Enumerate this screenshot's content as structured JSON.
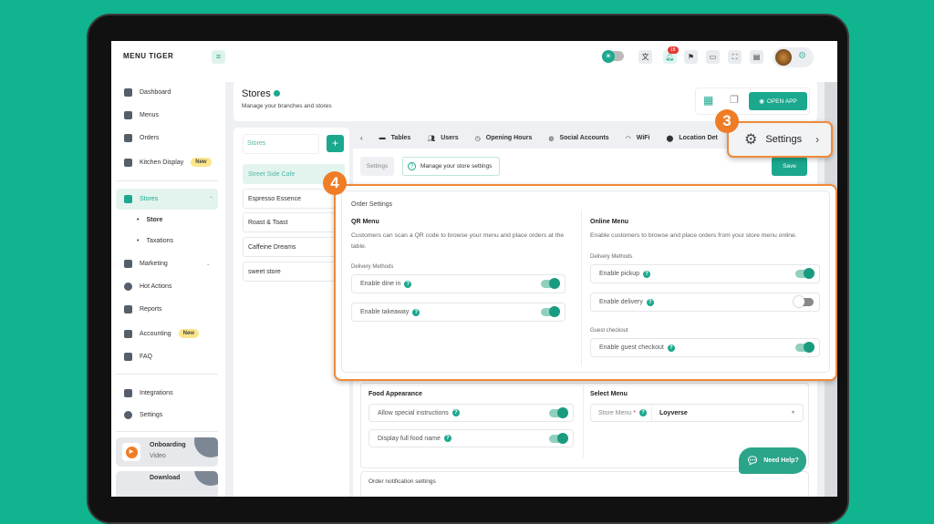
{
  "app": {
    "logo": "MENU TIGER",
    "notif_count": "18"
  },
  "sidebar": {
    "items": [
      {
        "label": "Dashboard"
      },
      {
        "label": "Menus"
      },
      {
        "label": "Orders"
      },
      {
        "label": "Kitchen Display",
        "badge": "New"
      },
      {
        "label": "Stores"
      },
      {
        "label": "Store"
      },
      {
        "label": "Taxations"
      },
      {
        "label": "Marketing"
      },
      {
        "label": "Hot Actions"
      },
      {
        "label": "Reports"
      },
      {
        "label": "Accounting",
        "badge": "New"
      },
      {
        "label": "FAQ"
      },
      {
        "label": "Integrations"
      },
      {
        "label": "Settings"
      }
    ],
    "onboarding": {
      "title": "Onboarding",
      "sub": "Video"
    },
    "download": {
      "title": "Download"
    }
  },
  "header": {
    "title": "Stores",
    "subtitle": "Manage your branches and stores",
    "open_app": "OPEN APP"
  },
  "stores": {
    "label": "Stores",
    "add": "+",
    "list": [
      "Street Side Cafe",
      "Espresso Essence",
      "Roast & Toast",
      "Caffeine Dreams",
      "sweet store"
    ]
  },
  "tabs": [
    "Tables",
    "Users",
    "Opening Hours",
    "Social Accounts",
    "WiFi",
    "Location Det"
  ],
  "callout": {
    "step3": "3",
    "settings": "Settings",
    "step4": "4"
  },
  "toolbar": {
    "settings": "Settings",
    "manage": "Manage your store settings",
    "save": "Save"
  },
  "order_settings": {
    "title": "Order Settings",
    "qr": {
      "title": "QR Menu",
      "desc": "Customers can scan a QR code to browse your menu and place orders at the table.",
      "delivery_label": "Delivery Methods",
      "rows": [
        {
          "label": "Enable dine in",
          "on": true
        },
        {
          "label": "Enable takeaway",
          "on": true
        }
      ]
    },
    "online": {
      "title": "Online Menu",
      "desc": "Enable customers to browse and place orders from your store menu online.",
      "delivery_label": "Delivery Methods",
      "rows": [
        {
          "label": "Enable pickup",
          "on": true
        },
        {
          "label": "Enable delivery",
          "on": false
        }
      ],
      "guest_label": "Guest checkout",
      "guest": {
        "label": "Enable guest checkout",
        "on": true
      }
    }
  },
  "food": {
    "title": "Food Appearance",
    "rows": [
      {
        "label": "Allow special instructions",
        "on": true
      },
      {
        "label": "Display full food name",
        "on": true
      }
    ]
  },
  "select_menu": {
    "title": "Select Menu",
    "field_label": "Store Menu",
    "required": "*",
    "value": "Loyverse"
  },
  "notifications": {
    "title": "Order notification settings"
  },
  "help": {
    "label": "Need Help?"
  },
  "colors": {
    "brand": "#1ba88e",
    "accent": "#ef7d26",
    "background": "#10b48e"
  }
}
